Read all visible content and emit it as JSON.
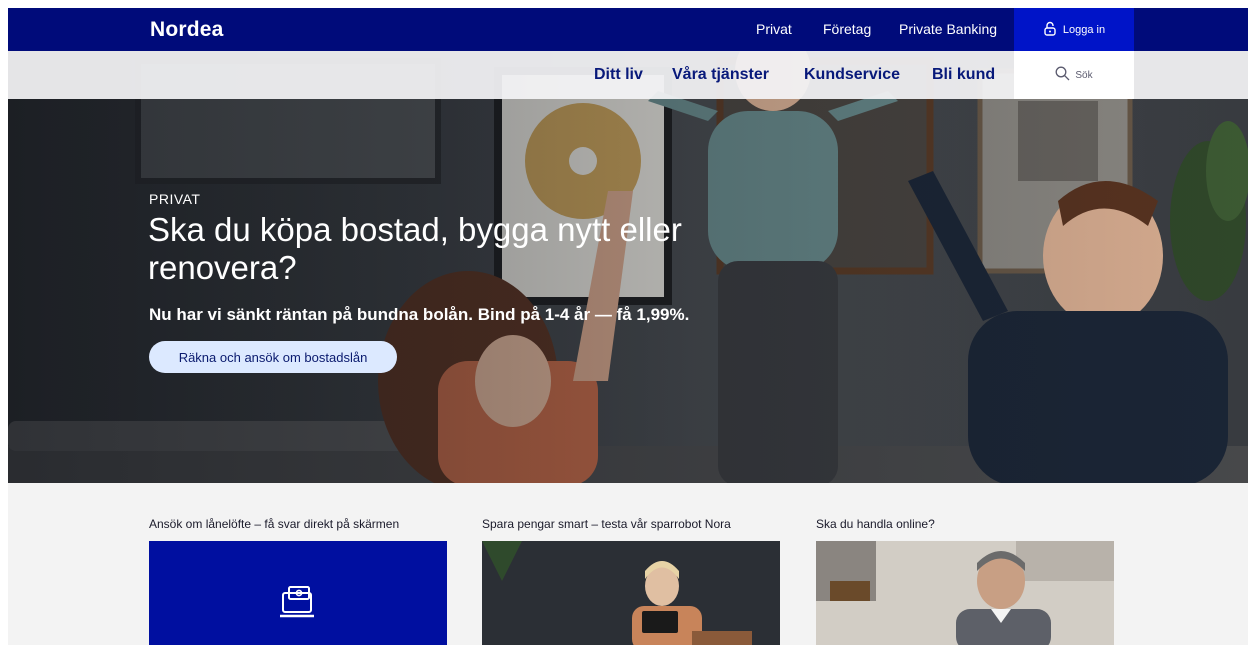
{
  "brand": {
    "logo_text": "Nordea"
  },
  "topbar": {
    "segments": [
      "Privat",
      "Företag",
      "Private Banking"
    ],
    "login_label": "Logga in"
  },
  "nav": {
    "items": [
      "Ditt liv",
      "Våra tjänster",
      "Kundservice",
      "Bli kund"
    ],
    "search_label": "Sök"
  },
  "hero": {
    "eyebrow": "PRIVAT",
    "headline": "Ska du köpa bostad, bygga nytt eller renovera?",
    "subline": "Nu har vi sänkt räntan på bundna bolån. Bind på 1-4 år — få 1,99%.",
    "cta_label": "Räkna och ansök om bostadslån"
  },
  "cards": [
    {
      "title": "Ansök om lånelöfte – få svar direkt på skärmen",
      "media": "blue-panel-with-laptop-icon"
    },
    {
      "title": "Spara pengar smart – testa vår sparrobot Nora",
      "media": "photo-woman-with-tablet"
    },
    {
      "title": "Ska du handla online?",
      "media": "photo-man-at-laptop"
    }
  ],
  "colors": {
    "topbar_bg": "#000b7a",
    "login_bg": "#0014c8",
    "nav_text": "#08197a",
    "cta_bg": "#dce9ff",
    "card_blue": "#000fa0"
  }
}
